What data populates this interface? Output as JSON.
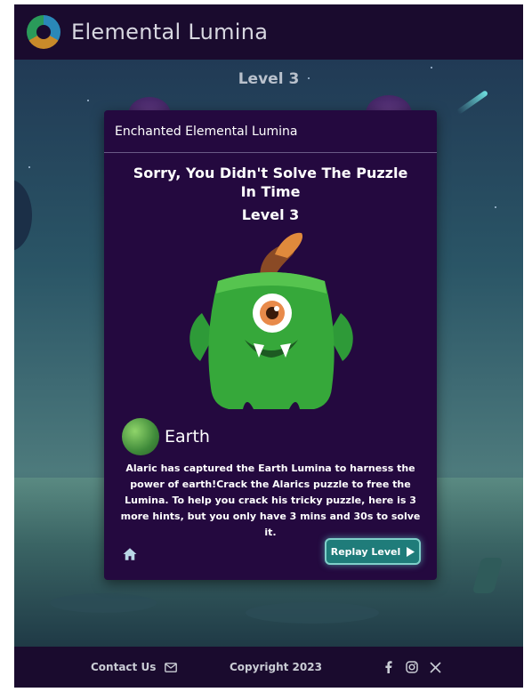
{
  "header": {
    "title": "Elemental Lumina",
    "logo_icon": "elemental-logo-icon"
  },
  "game": {
    "level_label": "Level 3"
  },
  "modal": {
    "title": "Enchanted Elemental Lumina",
    "message": "Sorry, You Didn't Solve The Puzzle In Time",
    "level": "Level 3",
    "character_icon": "green-one-eyed-monster",
    "element": {
      "name": "Earth",
      "icon": "earth-orb-icon"
    },
    "story": "Alaric has captured the Earth Lumina to harness the power of earth!Crack the Alarics puzzle to free the Lumina. To help you crack his tricky puzzle, here is 3 more hints, but you only have 3 mins and 30s to solve it.",
    "home_icon": "home-icon",
    "replay_label": "Replay Level",
    "replay_icon": "play-icon"
  },
  "footer": {
    "contact_label": "Contact Us",
    "contact_icon": "envelope-icon",
    "copyright": "Copyright 2023",
    "socials": [
      "facebook-icon",
      "instagram-icon",
      "x-icon"
    ]
  },
  "colors": {
    "header_bg": "#1a0b2e",
    "modal_bg": "#24093f",
    "replay_button": "#1f7c7a",
    "replay_border": "#7fcfc9"
  }
}
